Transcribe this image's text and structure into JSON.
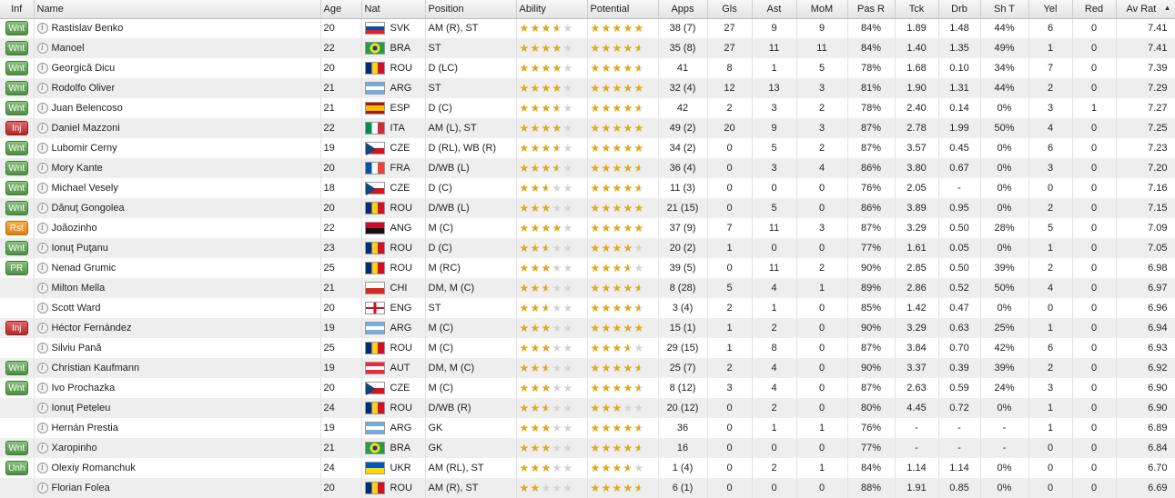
{
  "columns": {
    "inf": "Inf",
    "name": "Name",
    "age": "Age",
    "nat": "Nat",
    "position": "Position",
    "ability": "Ability",
    "potential": "Potential",
    "apps": "Apps",
    "gls": "Gls",
    "ast": "Ast",
    "mom": "MoM",
    "pas_r": "Pas R",
    "tck": "Tck",
    "drb": "Drb",
    "sh_t": "Sh T",
    "yel": "Yel",
    "red": "Red",
    "av_rat": "Av Rat"
  },
  "sort": {
    "column": "av_rat",
    "direction": "desc",
    "indicator": "▲"
  },
  "colors": {
    "badge_green": "#4f8f44",
    "badge_red": "#b32626",
    "badge_orange": "#e07f10",
    "star": "#e0a91c"
  },
  "info_glyph": "i",
  "players": [
    {
      "inf": "Wnt",
      "name": "Rastislav Benko",
      "age": "20",
      "nat": "SVK",
      "flag": "svk",
      "position": "AM (R), ST",
      "ability": 3.5,
      "potential": 5,
      "apps": "38 (7)",
      "gls": "27",
      "ast": "9",
      "mom": "9",
      "pas_r": "84%",
      "tck": "1.89",
      "drb": "1.48",
      "sh_t": "44%",
      "yel": "6",
      "red": "0",
      "av_rat": "7.41"
    },
    {
      "inf": "Wnt",
      "name": "Manoel",
      "age": "22",
      "nat": "BRA",
      "flag": "bra",
      "position": "ST",
      "ability": 4,
      "potential": 4.5,
      "apps": "35 (8)",
      "gls": "27",
      "ast": "11",
      "mom": "11",
      "pas_r": "84%",
      "tck": "1.40",
      "drb": "1.35",
      "sh_t": "49%",
      "yel": "1",
      "red": "0",
      "av_rat": "7.41"
    },
    {
      "inf": "Wnt",
      "name": "Georgică Dicu",
      "age": "20",
      "nat": "ROU",
      "flag": "rou",
      "position": "D (LC)",
      "ability": 4,
      "potential": 4.5,
      "apps": "41",
      "gls": "8",
      "ast": "1",
      "mom": "5",
      "pas_r": "78%",
      "tck": "1.68",
      "drb": "0.10",
      "sh_t": "34%",
      "yel": "7",
      "red": "0",
      "av_rat": "7.39"
    },
    {
      "inf": "Wnt",
      "name": "Rodolfo Oliver",
      "age": "21",
      "nat": "ARG",
      "flag": "arg",
      "position": "ST",
      "ability": 4,
      "potential": 5,
      "apps": "32 (4)",
      "gls": "12",
      "ast": "13",
      "mom": "3",
      "pas_r": "81%",
      "tck": "1.90",
      "drb": "1.31",
      "sh_t": "44%",
      "yel": "2",
      "red": "0",
      "av_rat": "7.29"
    },
    {
      "inf": "Wnt",
      "name": "Juan Belencoso",
      "age": "21",
      "nat": "ESP",
      "flag": "esp",
      "position": "D (C)",
      "ability": 3.5,
      "potential": 4.5,
      "apps": "42",
      "gls": "2",
      "ast": "3",
      "mom": "2",
      "pas_r": "78%",
      "tck": "2.40",
      "drb": "0.14",
      "sh_t": "0%",
      "yel": "3",
      "red": "1",
      "av_rat": "7.27"
    },
    {
      "inf": "Inj",
      "name": "Daniel Mazzoni",
      "age": "22",
      "nat": "ITA",
      "flag": "ita",
      "position": "AM (L), ST",
      "ability": 4,
      "potential": 5,
      "apps": "49 (2)",
      "gls": "20",
      "ast": "9",
      "mom": "3",
      "pas_r": "87%",
      "tck": "2.78",
      "drb": "1.99",
      "sh_t": "50%",
      "yel": "4",
      "red": "0",
      "av_rat": "7.25"
    },
    {
      "inf": "Wnt",
      "name": "Lubomir Cerny",
      "age": "19",
      "nat": "CZE",
      "flag": "cze",
      "position": "D (RL), WB (R)",
      "ability": 3.5,
      "potential": 5,
      "apps": "34 (2)",
      "gls": "0",
      "ast": "5",
      "mom": "2",
      "pas_r": "87%",
      "tck": "3.57",
      "drb": "0.45",
      "sh_t": "0%",
      "yel": "6",
      "red": "0",
      "av_rat": "7.23"
    },
    {
      "inf": "Wnt",
      "name": "Mory Kante",
      "age": "20",
      "nat": "FRA",
      "flag": "fra",
      "position": "D/WB (L)",
      "ability": 3.5,
      "potential": 4.5,
      "apps": "36 (4)",
      "gls": "0",
      "ast": "3",
      "mom": "4",
      "pas_r": "86%",
      "tck": "3.80",
      "drb": "0.67",
      "sh_t": "0%",
      "yel": "3",
      "red": "0",
      "av_rat": "7.20"
    },
    {
      "inf": "Wnt",
      "name": "Michael Vesely",
      "age": "18",
      "nat": "CZE",
      "flag": "cze",
      "position": "D (C)",
      "ability": 2.5,
      "potential": 4.5,
      "apps": "11 (3)",
      "gls": "0",
      "ast": "0",
      "mom": "0",
      "pas_r": "76%",
      "tck": "2.05",
      "drb": "-",
      "sh_t": "0%",
      "yel": "0",
      "red": "0",
      "av_rat": "7.16"
    },
    {
      "inf": "Wnt",
      "name": "Dănuţ Gongolea",
      "age": "20",
      "nat": "ROU",
      "flag": "rou",
      "position": "D/WB (L)",
      "ability": 3,
      "potential": 5,
      "apps": "21 (15)",
      "gls": "0",
      "ast": "5",
      "mom": "0",
      "pas_r": "86%",
      "tck": "3.89",
      "drb": "0.95",
      "sh_t": "0%",
      "yel": "2",
      "red": "0",
      "av_rat": "7.15"
    },
    {
      "inf": "Rst",
      "name": "Joãozinho",
      "age": "22",
      "nat": "ANG",
      "flag": "ang",
      "position": "M (C)",
      "ability": 4,
      "potential": 5,
      "apps": "37 (9)",
      "gls": "7",
      "ast": "11",
      "mom": "3",
      "pas_r": "87%",
      "tck": "3.29",
      "drb": "0.50",
      "sh_t": "28%",
      "yel": "5",
      "red": "0",
      "av_rat": "7.09"
    },
    {
      "inf": "Wnt",
      "name": "Ionuţ Puţanu",
      "age": "23",
      "nat": "ROU",
      "flag": "rou",
      "position": "D (C)",
      "ability": 2.5,
      "potential": 4,
      "apps": "20 (2)",
      "gls": "1",
      "ast": "0",
      "mom": "0",
      "pas_r": "77%",
      "tck": "1.61",
      "drb": "0.05",
      "sh_t": "0%",
      "yel": "1",
      "red": "0",
      "av_rat": "7.05"
    },
    {
      "inf": "PR",
      "name": "Nenad Grumic",
      "age": "25",
      "nat": "ROU",
      "flag": "rou",
      "position": "M (RC)",
      "ability": 3,
      "potential": 3.5,
      "apps": "39 (5)",
      "gls": "0",
      "ast": "11",
      "mom": "2",
      "pas_r": "90%",
      "tck": "2.85",
      "drb": "0.50",
      "sh_t": "39%",
      "yel": "2",
      "red": "0",
      "av_rat": "6.98"
    },
    {
      "inf": "",
      "name": "Milton Mella",
      "age": "21",
      "nat": "CHI",
      "flag": "chi",
      "position": "DM, M (C)",
      "ability": 2.5,
      "potential": 4.5,
      "apps": "8 (28)",
      "gls": "5",
      "ast": "4",
      "mom": "1",
      "pas_r": "89%",
      "tck": "2.86",
      "drb": "0.52",
      "sh_t": "50%",
      "yel": "4",
      "red": "0",
      "av_rat": "6.97"
    },
    {
      "inf": "",
      "name": "Scott Ward",
      "age": "20",
      "nat": "ENG",
      "flag": "eng",
      "position": "ST",
      "ability": 2.5,
      "potential": 4.5,
      "apps": "3 (4)",
      "gls": "2",
      "ast": "1",
      "mom": "0",
      "pas_r": "85%",
      "tck": "1.42",
      "drb": "0.47",
      "sh_t": "0%",
      "yel": "0",
      "red": "0",
      "av_rat": "6.96"
    },
    {
      "inf": "Inj",
      "name": "Héctor Fernández",
      "age": "19",
      "nat": "ARG",
      "flag": "arg",
      "position": "M (C)",
      "ability": 3,
      "potential": 5,
      "apps": "15 (1)",
      "gls": "1",
      "ast": "2",
      "mom": "0",
      "pas_r": "90%",
      "tck": "3.29",
      "drb": "0.63",
      "sh_t": "25%",
      "yel": "1",
      "red": "0",
      "av_rat": "6.94"
    },
    {
      "inf": "",
      "name": "Silviu Pană",
      "age": "25",
      "nat": "ROU",
      "flag": "rou",
      "position": "M (C)",
      "ability": 3,
      "potential": 3.5,
      "apps": "29 (15)",
      "gls": "1",
      "ast": "8",
      "mom": "0",
      "pas_r": "87%",
      "tck": "3.84",
      "drb": "0.70",
      "sh_t": "42%",
      "yel": "6",
      "red": "0",
      "av_rat": "6.93"
    },
    {
      "inf": "Wnt",
      "name": "Christian Kaufmann",
      "age": "19",
      "nat": "AUT",
      "flag": "aut",
      "position": "DM, M (C)",
      "ability": 2.5,
      "potential": 4.5,
      "apps": "25 (7)",
      "gls": "2",
      "ast": "4",
      "mom": "0",
      "pas_r": "90%",
      "tck": "3.37",
      "drb": "0.39",
      "sh_t": "39%",
      "yel": "2",
      "red": "0",
      "av_rat": "6.92"
    },
    {
      "inf": "Wnt",
      "name": "Ivo Prochazka",
      "age": "20",
      "nat": "CZE",
      "flag": "cze",
      "position": "M (C)",
      "ability": 3,
      "potential": 4.5,
      "apps": "8 (12)",
      "gls": "3",
      "ast": "4",
      "mom": "0",
      "pas_r": "87%",
      "tck": "2.63",
      "drb": "0.59",
      "sh_t": "24%",
      "yel": "3",
      "red": "0",
      "av_rat": "6.90"
    },
    {
      "inf": "",
      "name": "Ionuţ Peteleu",
      "age": "24",
      "nat": "ROU",
      "flag": "rou",
      "position": "D/WB (R)",
      "ability": 2.5,
      "potential": 3,
      "apps": "20 (12)",
      "gls": "0",
      "ast": "2",
      "mom": "0",
      "pas_r": "80%",
      "tck": "4.45",
      "drb": "0.72",
      "sh_t": "0%",
      "yel": "1",
      "red": "0",
      "av_rat": "6.90"
    },
    {
      "inf": "",
      "name": "Hernán Prestia",
      "age": "19",
      "nat": "ARG",
      "flag": "arg",
      "position": "GK",
      "ability": 3,
      "potential": 4.5,
      "apps": "36",
      "gls": "0",
      "ast": "1",
      "mom": "1",
      "pas_r": "76%",
      "tck": "-",
      "drb": "-",
      "sh_t": "-",
      "yel": "1",
      "red": "0",
      "av_rat": "6.89"
    },
    {
      "inf": "Wnt",
      "name": "Xaropinho",
      "age": "21",
      "nat": "BRA",
      "flag": "bra",
      "position": "GK",
      "ability": 3,
      "potential": 4.5,
      "apps": "16",
      "gls": "0",
      "ast": "0",
      "mom": "0",
      "pas_r": "77%",
      "tck": "-",
      "drb": "-",
      "sh_t": "-",
      "yel": "0",
      "red": "0",
      "av_rat": "6.84"
    },
    {
      "inf": "Unh",
      "name": "Olexiy Romanchuk",
      "age": "24",
      "nat": "UKR",
      "flag": "ukr",
      "position": "AM (RL), ST",
      "ability": 3,
      "potential": 3.5,
      "apps": "1 (4)",
      "gls": "0",
      "ast": "2",
      "mom": "1",
      "pas_r": "84%",
      "tck": "1.14",
      "drb": "1.14",
      "sh_t": "0%",
      "yel": "0",
      "red": "0",
      "av_rat": "6.70"
    },
    {
      "inf": "",
      "name": "Florian Folea",
      "age": "20",
      "nat": "ROU",
      "flag": "rou",
      "position": "AM (R), ST",
      "ability": 2,
      "potential": 4.5,
      "apps": "6 (1)",
      "gls": "0",
      "ast": "0",
      "mom": "0",
      "pas_r": "88%",
      "tck": "1.91",
      "drb": "0.85",
      "sh_t": "0%",
      "yel": "0",
      "red": "0",
      "av_rat": "6.69"
    }
  ]
}
